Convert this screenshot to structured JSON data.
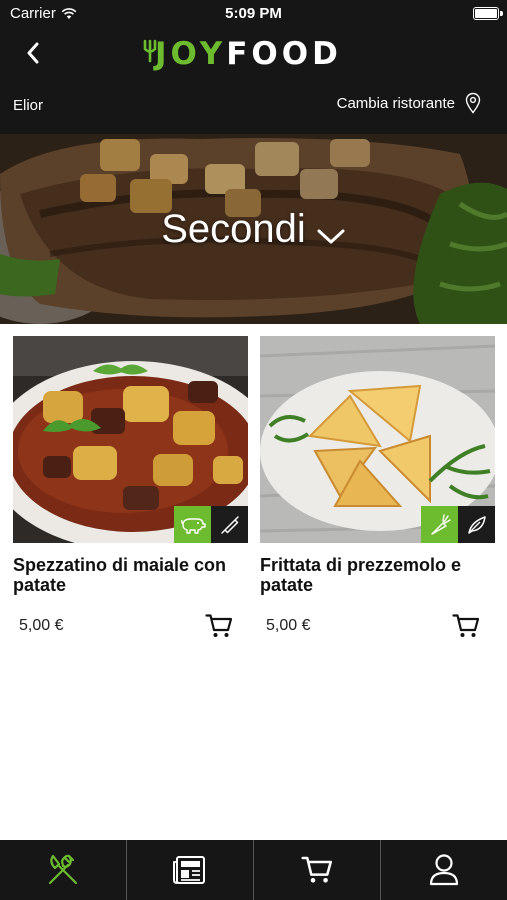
{
  "status_bar": {
    "carrier": "Carrier",
    "time": "5:09 PM"
  },
  "header": {
    "logo_joy": "JOY",
    "logo_food": "FOOD",
    "restaurant_name": "Elior",
    "change_restaurant_label": "Cambia ristorante"
  },
  "hero": {
    "category_title": "Secondi"
  },
  "products": [
    {
      "name": "Spezzatino di maiale con patate",
      "price": "5,00 €",
      "badges": [
        "pig-icon",
        "rolling-pin-icon"
      ]
    },
    {
      "name": "Frittata di prezzemolo e patate",
      "price": "5,00 €",
      "badges": [
        "carrot-icon",
        "leaf-icon"
      ]
    }
  ],
  "tab_bar": {
    "tabs": [
      {
        "icon": "fork-knife-icon",
        "active": true
      },
      {
        "icon": "newspaper-icon",
        "active": false
      },
      {
        "icon": "cart-icon",
        "active": false
      },
      {
        "icon": "user-icon",
        "active": false
      }
    ]
  },
  "colors": {
    "brand_green": "#6dbb2e",
    "bar_background": "#161616"
  }
}
